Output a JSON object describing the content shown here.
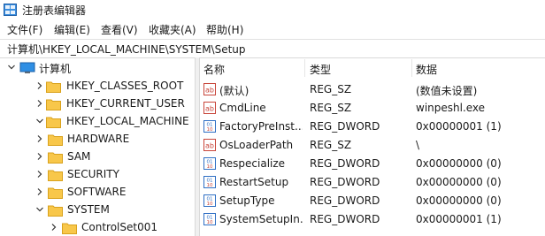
{
  "window": {
    "title": "注册表编辑器",
    "accent": "#1b6ac9"
  },
  "menu": [
    "文件(F)",
    "编辑(E)",
    "查看(V)",
    "收藏夹(A)",
    "帮助(H)"
  ],
  "address": {
    "path": "计算机\\HKEY_LOCAL_MACHINE\\SYSTEM\\Setup"
  },
  "tree": {
    "root": "计算机",
    "items": [
      {
        "label": "HKEY_CLASSES_ROOT",
        "state": "collapsed"
      },
      {
        "label": "HKEY_CURRENT_USER",
        "state": "collapsed"
      },
      {
        "label": "HKEY_LOCAL_MACHINE",
        "state": "expanded"
      },
      {
        "label": "HARDWARE",
        "state": "collapsed"
      },
      {
        "label": "SAM",
        "state": "collapsed"
      },
      {
        "label": "SECURITY",
        "state": "collapsed"
      },
      {
        "label": "SOFTWARE",
        "state": "collapsed"
      },
      {
        "label": "SYSTEM",
        "state": "expanded"
      },
      {
        "label": "ControlSet001",
        "state": "collapsed"
      }
    ]
  },
  "values": {
    "headers": {
      "name": "名称",
      "type": "类型",
      "data": "数据"
    },
    "rows": [
      {
        "name": "(默认)",
        "type": "REG_SZ",
        "data": "(数值未设置)",
        "icon": "string-value-icon"
      },
      {
        "name": "CmdLine",
        "type": "REG_SZ",
        "data": "winpeshl.exe",
        "icon": "string-value-icon"
      },
      {
        "name": "FactoryPreInst...",
        "type": "REG_DWORD",
        "data": "0x00000001 (1)",
        "icon": "binary-value-icon"
      },
      {
        "name": "OsLoaderPath",
        "type": "REG_SZ",
        "data": "\\",
        "icon": "string-value-icon"
      },
      {
        "name": "Respecialize",
        "type": "REG_DWORD",
        "data": "0x00000000 (0)",
        "icon": "binary-value-icon"
      },
      {
        "name": "RestartSetup",
        "type": "REG_DWORD",
        "data": "0x00000000 (0)",
        "icon": "binary-value-icon"
      },
      {
        "name": "SetupType",
        "type": "REG_DWORD",
        "data": "0x00000000 (0)",
        "icon": "binary-value-icon"
      },
      {
        "name": "SystemSetupIn...",
        "type": "REG_DWORD",
        "data": "0x00000001 (1)",
        "icon": "binary-value-icon"
      }
    ]
  }
}
